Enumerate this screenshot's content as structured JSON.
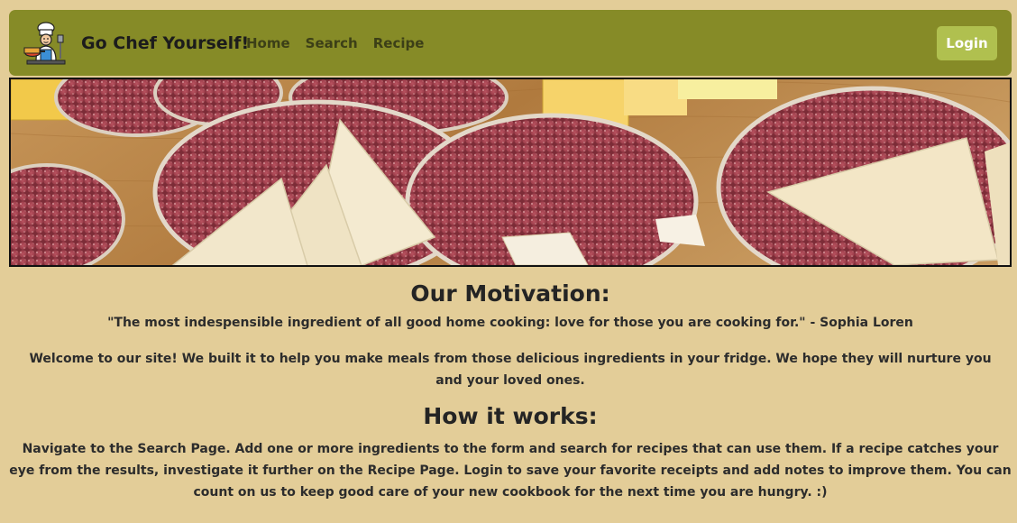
{
  "navbar": {
    "logo_icon": "chef-cooking-icon",
    "brand": "Go Chef Yourself!",
    "links": [
      "Home",
      "Search",
      "Recipe"
    ],
    "login_label": "Login",
    "background": "#868b27",
    "login_color": "#b0c04f"
  },
  "banner": {
    "image": "salami-and-cheese-board-photo"
  },
  "main": {
    "motivation_heading": "Our Motivation:",
    "quote": "\"The most indespensible ingredient of all good home cooking: love for those you are cooking for.\" - Sophia Loren",
    "welcome": "Welcome to our site! We built it to help you make meals from those delicious ingredients in your fridge. We hope they will nurture you and your loved ones.",
    "how_heading": "How it works:",
    "how_text": "Navigate to the Search Page. Add one or more ingredients to the form and search for recipes that can use them. If a recipe catches your eye from the results, investigate it further on the Recipe Page. Login to save your favorite receipts and add notes to improve them. You can count on us to keep good care of your new cookbook for the next time you are hungry. :)"
  },
  "colors": {
    "page_background": "#e3cd98",
    "text": "#2c2c2c"
  }
}
